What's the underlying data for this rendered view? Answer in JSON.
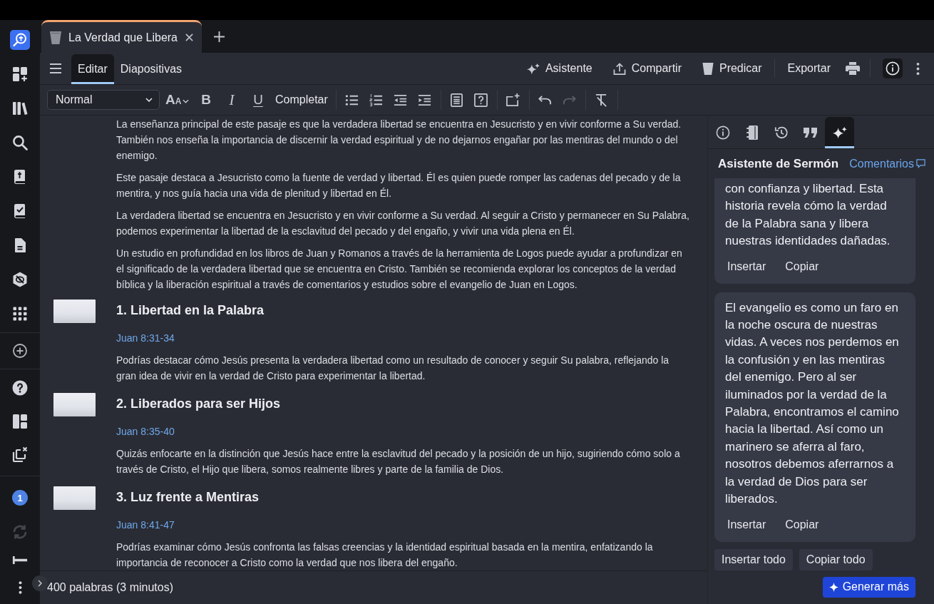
{
  "sidebar": {
    "badge": "1",
    "sync_disabled": true
  },
  "tabs": [
    {
      "title": "La Verdad que Libera",
      "selected": true
    }
  ],
  "toolbar": {
    "modes": [
      {
        "label": "Editar",
        "selected": true
      },
      {
        "label": "Diapositivas",
        "selected": false
      }
    ],
    "actions": [
      {
        "kind": "assistant",
        "label": "Asistente"
      },
      {
        "kind": "share",
        "label": "Compartir"
      },
      {
        "kind": "preach",
        "label": "Predicar"
      }
    ],
    "export": "Exportar",
    "info_selected": true
  },
  "format_bar": {
    "style": "Normal",
    "font_size": {
      "large": "A",
      "small": "A"
    },
    "marks": [
      {
        "kind": "bold",
        "label": "B"
      },
      {
        "kind": "italic",
        "label": "I"
      },
      {
        "kind": "underline",
        "label": "U"
      }
    ],
    "complete": "Completar",
    "undo_disabled": false,
    "redo_disabled": true
  },
  "editor": {
    "paragraphs": [
      "La enseñanza principal de este pasaje es que la verdadera libertad se encuentra en Jesucristo y en vivir conforme a Su verdad. También nos enseña la importancia de discernir la verdad espiritual y de no dejarnos engañar por las mentiras del mundo o del enemigo.",
      "Este pasaje destaca a Jesucristo como la fuente de verdad y libertad. Él es quien puede romper las cadenas del pecado y de la mentira, y nos guía hacia una vida de plenitud y libertad en Él.",
      "La verdadera libertad se encuentra en Jesucristo y en vivir conforme a Su verdad. Al seguir a Cristo y permanecer en Su Palabra, podemos experimentar la libertad de la esclavitud del pecado y del engaño, y vivir una vida plena en Él.",
      "Un estudio en profundidad en los libros de Juan y Romanos a través de la herramienta de Logos puede ayudar a profundizar en el significado de la verdadera libertad que se encuentra en Cristo. También se recomienda explorar los conceptos de la verdad bíblica y la liberación espiritual a través de comentarios y estudios sobre el evangelio de Juan en Logos."
    ],
    "points": [
      {
        "title": "1. Libertad en la Palabra",
        "reference": "Juan 8:31-34",
        "text": "Podrías destacar cómo Jesús presenta la verdadera libertad como un resultado de conocer y seguir Su palabra, reflejando la gran idea de vivir en la verdad de Cristo para experimentar la libertad."
      },
      {
        "title": "2. Liberados para ser Hijos",
        "reference": "Juan 8:35-40",
        "text": "Quizás enfocarte en la distinción que Jesús hace entre la esclavitud del pecado y la posición de un hijo, sugiriendo cómo solo a través de Cristo, el Hijo que libera, somos realmente libres y parte de la familia de Dios."
      },
      {
        "title": "3. Luz frente a Mentiras",
        "reference": "Juan 8:41-47",
        "text": "Podrías examinar cómo Jesús confronta las falsas creencias y la identidad espiritual basada en la mentira, enfatizando la importancia de reconocer a Cristo como la verdad que nos libera del engaño."
      }
    ]
  },
  "assistant": {
    "tabs": [
      {
        "selected": false
      },
      {
        "selected": false
      },
      {
        "selected": false
      },
      {
        "selected": false
      },
      {
        "selected": true
      }
    ],
    "title": "Asistente de Sermón",
    "link": "Comentarios",
    "cards": [
      {
        "text": "con confianza y libertad. Esta historia revela cómo la verdad de la Palabra sana y libera nuestras identidades dañadas.",
        "actions": [
          "Insertar",
          "Copiar"
        ]
      },
      {
        "text": "El evangelio es como un faro en la noche oscura de nuestras vidas. A veces nos perdemos en la confusión y en las mentiras del enemigo. Pero al ser iluminados por la verdad de la Palabra, encontramos el camino hacia la libertad. Así como un marinero se aferra al faro, nosotros debemos aferrarnos a la verdad de Dios para ser liberados.",
        "actions": [
          "Insertar",
          "Copiar"
        ]
      }
    ],
    "bulk_actions": [
      "Insertar todo",
      "Copiar todo"
    ],
    "generate": "Generar más"
  },
  "status_bar": {
    "word_count": "400 palabras (3 minutos)"
  }
}
